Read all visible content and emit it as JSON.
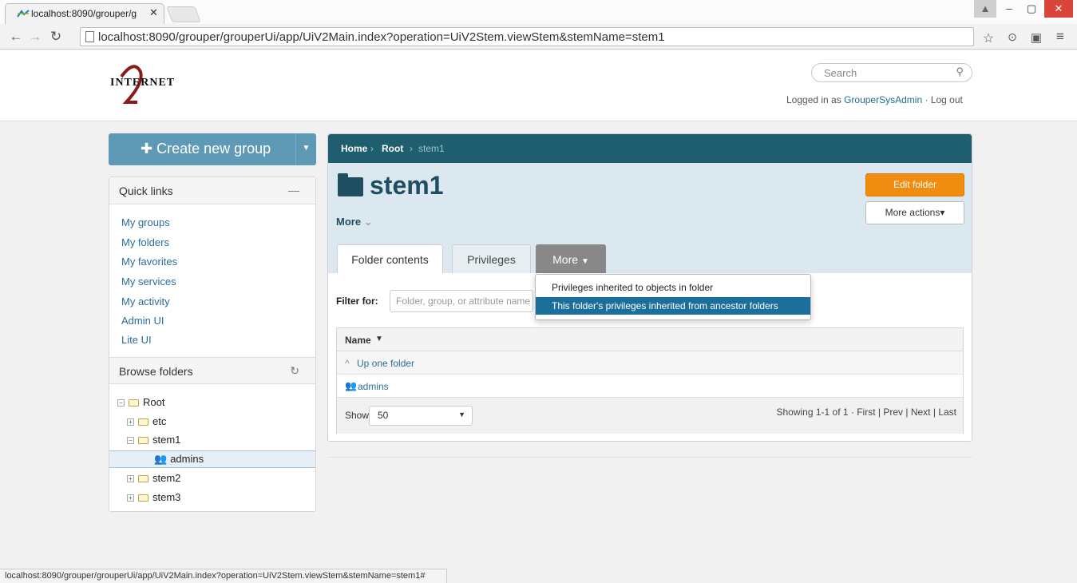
{
  "browser": {
    "tab_title": "localhost:8090/grouper/g",
    "url": "localhost:8090/grouper/grouperUi/app/UiV2Main.index?operation=UiV2Stem.viewStem&stemName=stem1",
    "status_url": "localhost:8090/grouper/grouperUi/app/UiV2Main.index?operation=UiV2Stem.viewStem&stemName=stem1#"
  },
  "header": {
    "logo_text": "INTERNET",
    "search_placeholder": "Search",
    "logged_in_prefix": "Logged in as",
    "user_name": "GrouperSysAdmin",
    "separator": "·",
    "logout": "Log out"
  },
  "sidebar": {
    "create_button": "Create new group",
    "quick_links_title": "Quick links",
    "quick_links": [
      "My groups",
      "My folders",
      "My favorites",
      "My services",
      "My activity",
      "Admin UI",
      "Lite UI"
    ],
    "browse_title": "Browse folders",
    "tree": [
      {
        "label": "Root",
        "level": 0,
        "expanded": true
      },
      {
        "label": "etc",
        "level": 1,
        "expanded": false
      },
      {
        "label": "stem1",
        "level": 1,
        "expanded": true
      },
      {
        "label": "admins",
        "level": 2,
        "type": "group",
        "selected": true
      },
      {
        "label": "stem2",
        "level": 1,
        "expanded": false
      },
      {
        "label": "stem3",
        "level": 1,
        "expanded": false
      }
    ]
  },
  "main": {
    "breadcrumb": [
      "Home",
      "Root",
      "stem1"
    ],
    "title": "stem1",
    "more_link": "More",
    "edit_button": "Edit folder",
    "more_actions_button": "More actions",
    "tabs": [
      "Folder contents",
      "Privileges",
      "More"
    ],
    "filter_label": "Filter for:",
    "filter_placeholder": "Folder, group, or attribute name",
    "table": {
      "header": "Name",
      "up_folder": "Up one folder",
      "rows": [
        "admins"
      ]
    },
    "pager": {
      "show_label": "Show:",
      "page_size": "50",
      "showing": "Showing 1-1 of 1",
      "first": "First",
      "prev": "Prev",
      "next": "Next",
      "last": "Last"
    }
  },
  "dropdown": {
    "items": [
      "Privileges inherited to objects in folder",
      "This folder's privileges inherited from ancestor folders"
    ],
    "highlight_color": "#1c6e9b"
  },
  "colors": {
    "header_bar": "#1e5e6e",
    "accent_orange": "#f08c10",
    "create_button": "#5e9ab5",
    "link": "#2a6e94"
  }
}
